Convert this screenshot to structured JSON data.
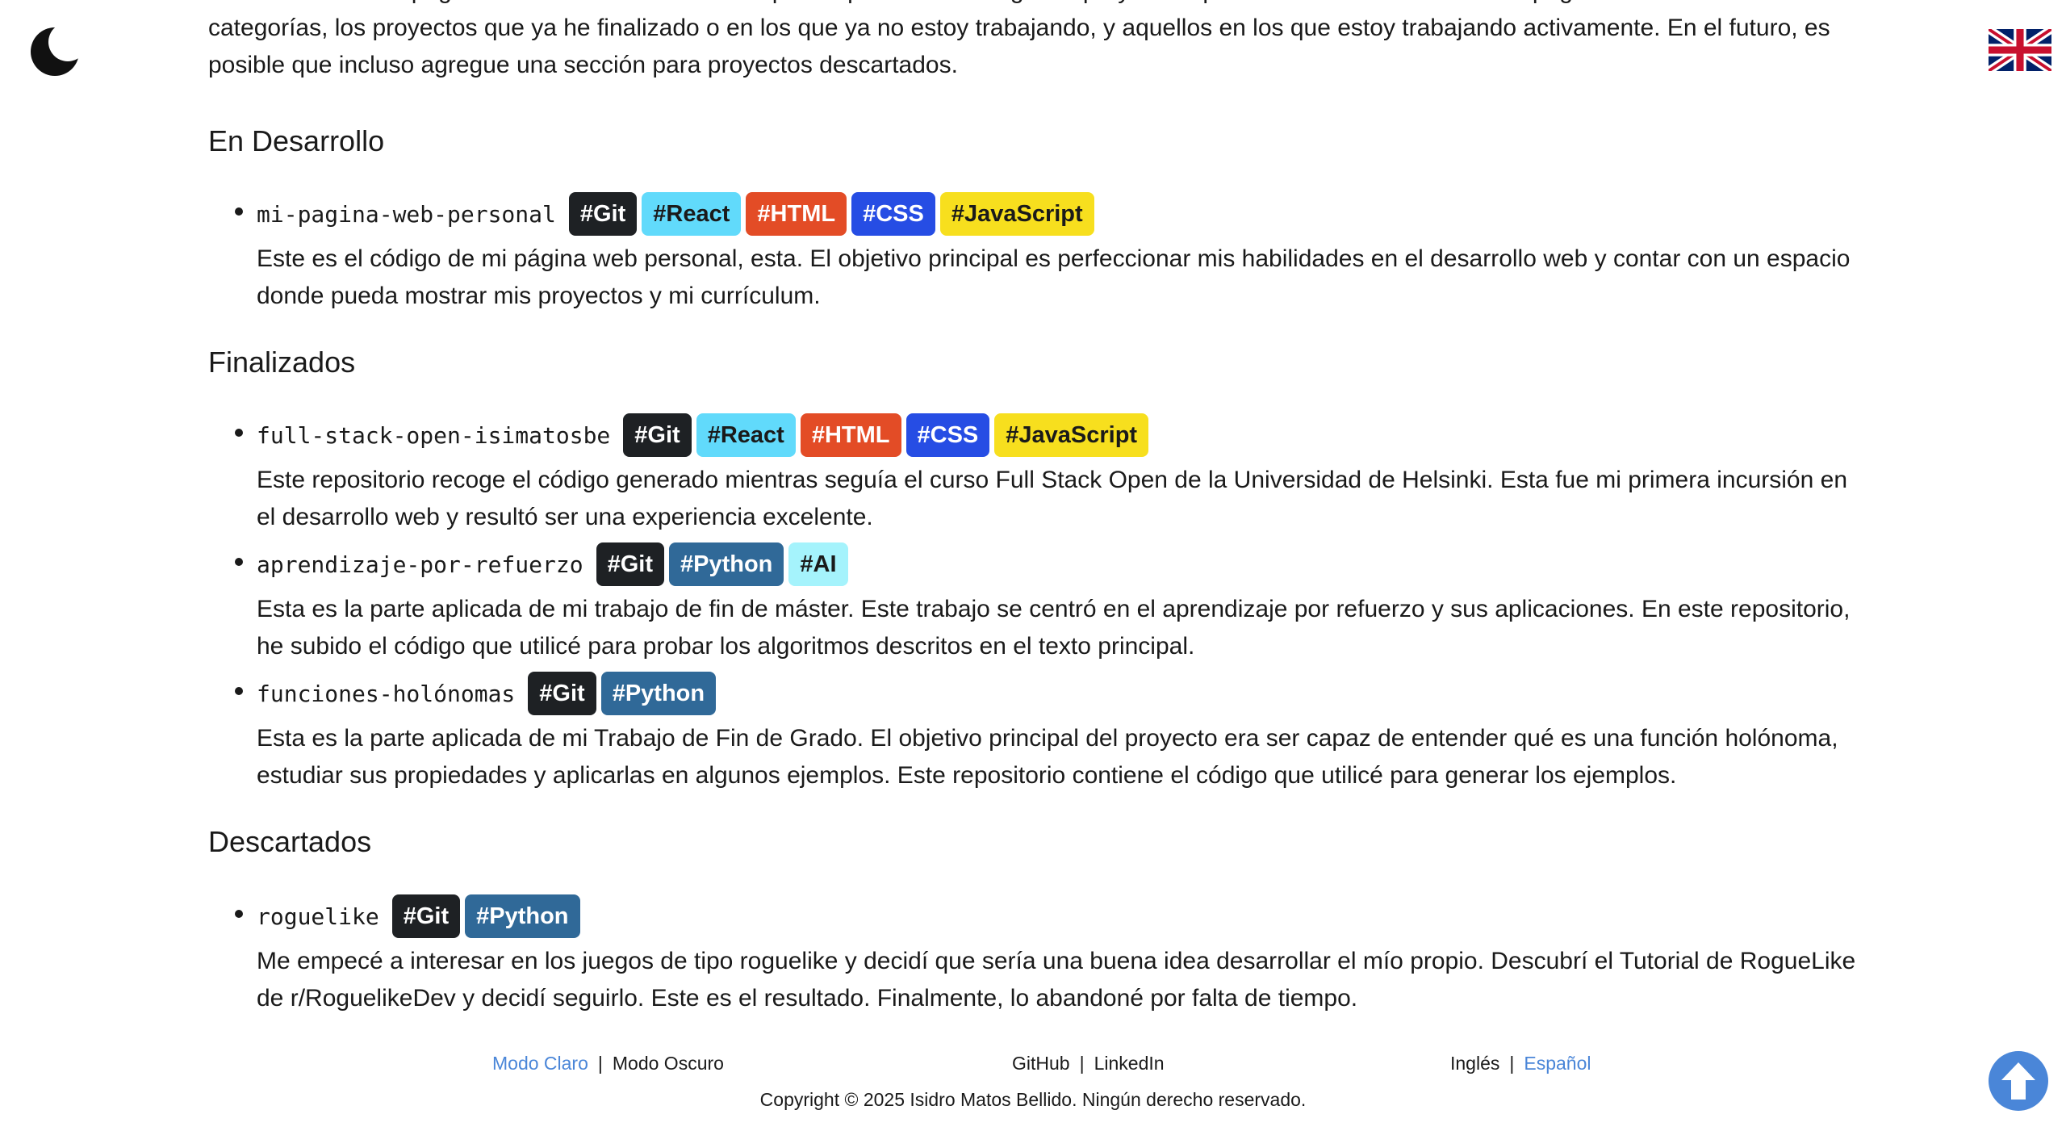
{
  "intro_text": "Esta sección de la página web servirá como un escaparate para mostrar algunos proyectos que considero interesantes. La página estará dividida en dos categorías, los proyectos que ya he finalizado o en los que ya no estoy trabajando, y aquellos en los que estoy trabajando activamente. En el futuro, es posible que incluso agregue una sección para proyectos descartados.",
  "colors": {
    "git": "#1e2124",
    "react": "#61dafb",
    "html": "#e34c26",
    "css": "#264de4",
    "javascript": "#f7df1e",
    "python": "#306998",
    "ai": "#a5f3fc",
    "accent": "#4a86d8"
  },
  "icons": {
    "theme": "moon-icon",
    "language": "uk-flag-icon",
    "scroll": "arrow-up-circle-icon"
  },
  "sections": [
    {
      "title": "En Desarrollo",
      "projects": [
        {
          "name": "mi-pagina-web-personal",
          "tags": [
            "#Git",
            "#React",
            "#HTML",
            "#CSS",
            "#JavaScript"
          ],
          "description": "Este es el código de mi página web personal, esta. El objetivo principal es perfeccionar mis habilidades en el desarrollo web y contar con un espacio donde pueda mostrar mis proyectos y mi currículum."
        }
      ]
    },
    {
      "title": "Finalizados",
      "projects": [
        {
          "name": "full-stack-open-isimatosbe",
          "tags": [
            "#Git",
            "#React",
            "#HTML",
            "#CSS",
            "#JavaScript"
          ],
          "description": "Este repositorio recoge el código generado mientras seguía el curso Full Stack Open de la Universidad de Helsinki. Esta fue mi primera incursión en el desarrollo web y resultó ser una experiencia excelente."
        },
        {
          "name": "aprendizaje-por-refuerzo",
          "tags": [
            "#Git",
            "#Python",
            "#AI"
          ],
          "description": "Esta es la parte aplicada de mi trabajo de fin de máster. Este trabajo se centró en el aprendizaje por refuerzo y sus aplicaciones. En este repositorio, he subido el código que utilicé para probar los algoritmos descritos en el texto principal."
        },
        {
          "name": "funciones-holónomas",
          "tags": [
            "#Git",
            "#Python"
          ],
          "description": "Esta es la parte aplicada de mi Trabajo de Fin de Grado. El objetivo principal del proyecto era ser capaz de entender qué es una función holónoma, estudiar sus propiedades y aplicarlas en algunos ejemplos. Este repositorio contiene el código que utilicé para generar los ejemplos."
        }
      ]
    },
    {
      "title": "Descartados",
      "projects": [
        {
          "name": "roguelike",
          "tags": [
            "#Git",
            "#Python"
          ],
          "description": "Me empecé a interesar en los juegos de tipo roguelike y decidí que sería una buena idea desarrollar el mío propio. Descubrí el Tutorial de RogueLike de r/RoguelikeDev y decidí seguirlo. Este es el resultado. Finalmente, lo abandoné por falta de tiempo."
        }
      ]
    }
  ],
  "footer": {
    "theme_light": "Modo Claro",
    "theme_dark": "Modo Oscuro",
    "github": "GitHub",
    "linkedin": "LinkedIn",
    "lang_en": "Inglés",
    "lang_es": "Español",
    "separator": "|",
    "copyright": "Copyright © 2025 Isidro Matos Bellido. Ningún derecho reservado."
  }
}
